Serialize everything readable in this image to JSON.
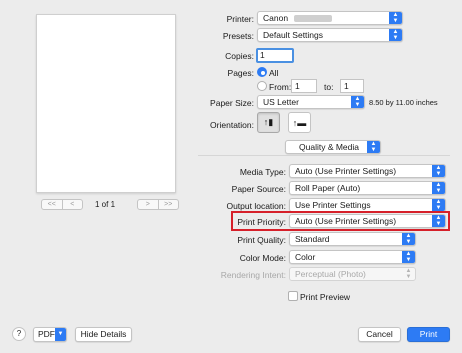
{
  "preview": {
    "pager_prev": [
      "<<",
      "<"
    ],
    "pager_next": [
      ">",
      ">>"
    ],
    "page_label": "1 of 1"
  },
  "printer": {
    "label": "Printer:",
    "value": "Canon"
  },
  "presets": {
    "label": "Presets:",
    "value": "Default Settings"
  },
  "copies": {
    "label": "Copies:",
    "value": "1"
  },
  "pages": {
    "label": "Pages:",
    "all_label": "All",
    "from_label": "From:",
    "from_value": "1",
    "to_label": "to:",
    "to_value": "1"
  },
  "paper_size": {
    "label": "Paper Size:",
    "value": "US Letter",
    "dimensions": "8.50 by 11.00 inches"
  },
  "orientation": {
    "label": "Orientation:",
    "portrait_glyph": "↑▮",
    "landscape_glyph": "↑▬"
  },
  "section_popup": {
    "value": "Quality & Media"
  },
  "media_type": {
    "label": "Media Type:",
    "value": "Auto (Use Printer Settings)"
  },
  "paper_source": {
    "label": "Paper Source:",
    "value": "Roll Paper (Auto)"
  },
  "output_location": {
    "label": "Output location:",
    "value": "Use Printer Settings"
  },
  "print_priority": {
    "label": "Print Priority:",
    "value": "Auto (Use Printer Settings)"
  },
  "print_quality": {
    "label": "Print Quality:",
    "value": "Standard"
  },
  "color_mode": {
    "label": "Color Mode:",
    "value": "Color"
  },
  "rendering_intent": {
    "label": "Rendering Intent:",
    "value": "Perceptual (Photo)"
  },
  "print_preview": {
    "label": "Print Preview"
  },
  "footer": {
    "help": "?",
    "pdf": "PDF",
    "hide_details": "Hide Details",
    "cancel": "Cancel",
    "print": "Print"
  },
  "icons": {
    "popup_arrow": "chevron-updown-icon",
    "help": "help-icon"
  },
  "colors": {
    "accent": "#2d7bf4",
    "highlight": "#d6202a",
    "background": "#ececec"
  }
}
